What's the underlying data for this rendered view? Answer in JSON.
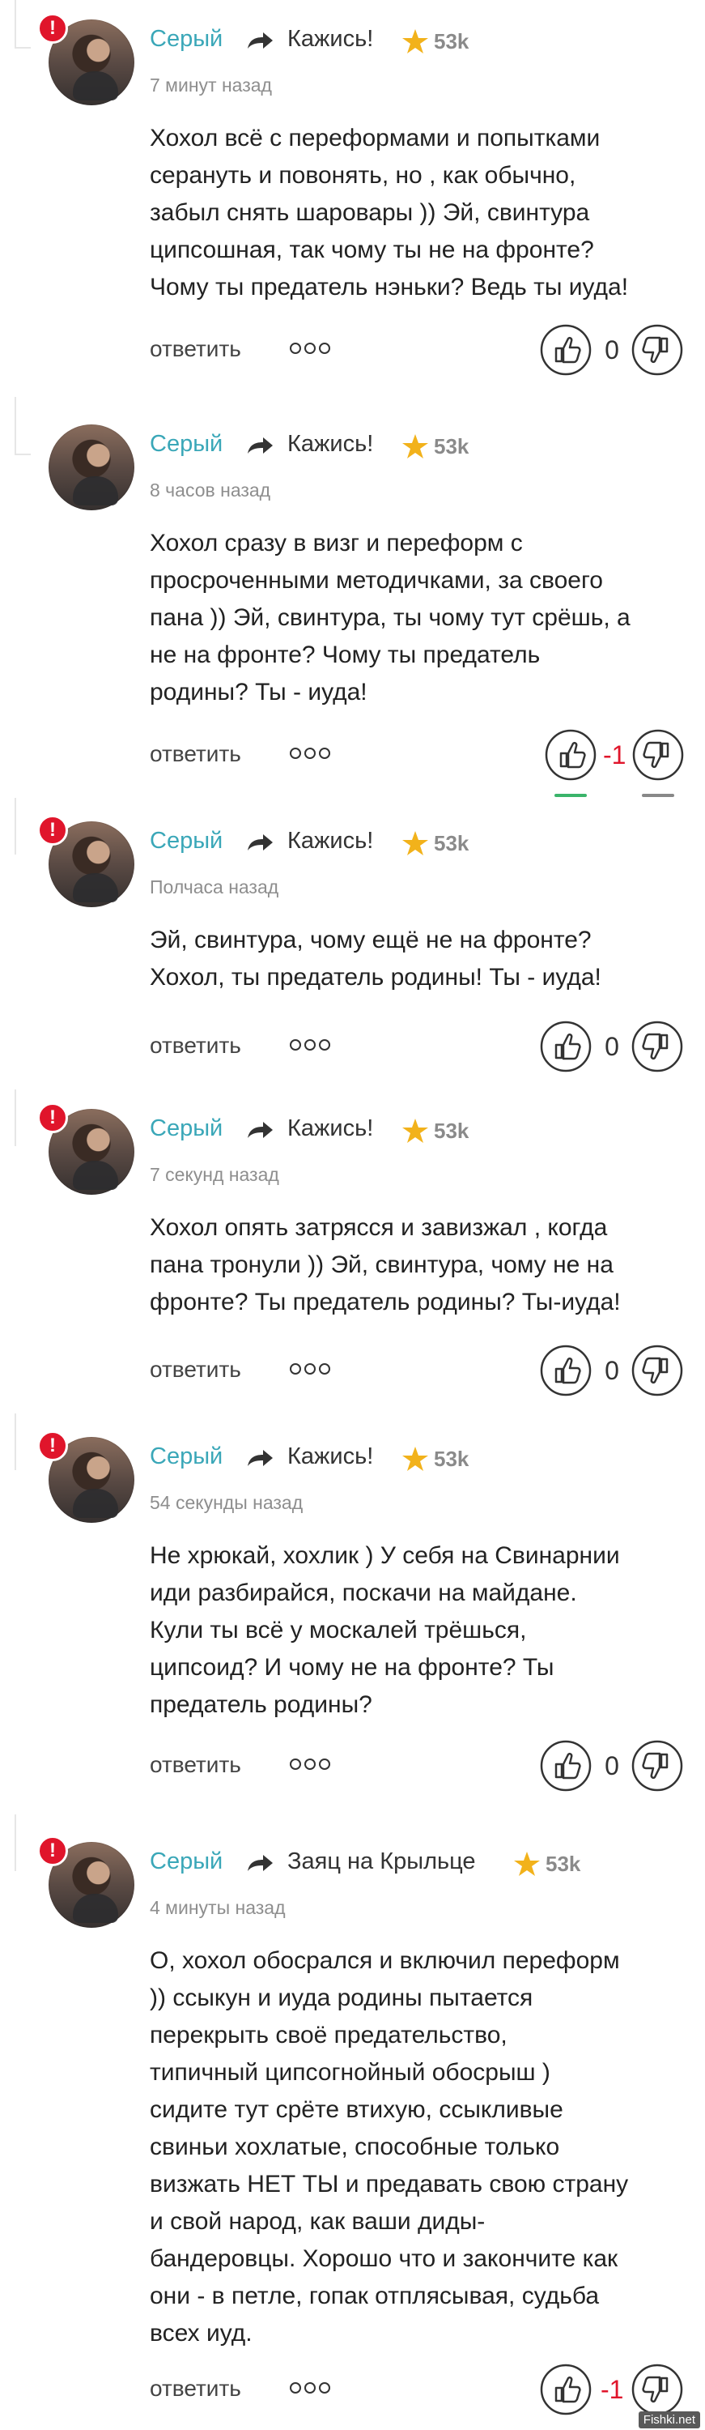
{
  "comments": [
    {
      "author": "Серый",
      "reply_to": "Кажись!",
      "rating": "53k",
      "time": "7 минут назад",
      "text": "Хохол всё с переформами и попытками\nсерануть и повонять, но , как обычно,\nзабыл снять шаровары )) Эй, свинтура\nципсошная, так чому ты не на фронте?\nЧому ты предатель нэньки? Ведь ты иуда!",
      "reply_label": "ответить",
      "score": "0",
      "score_negative": false,
      "flagged": true
    },
    {
      "author": "Серый",
      "reply_to": "Кажись!",
      "rating": "53k",
      "time": "8 часов назад",
      "text": "Хохол сразу в визг и переформ с\nпросроченными методичками, за своего\nпана )) Эй, свинтура, ты чому тут срёшь, а\nне на фронте? Чому ты предатель\nродины? Ты - иуда!",
      "reply_label": "ответить",
      "score": "-1",
      "score_negative": true,
      "flagged": false
    },
    {
      "author": "Серый",
      "reply_to": "Кажись!",
      "rating": "53k",
      "time": "Полчаса назад",
      "text": "Эй, свинтура, чому ещё не на фронте?\nХохол, ты предатель родины! Ты - иуда!",
      "reply_label": "ответить",
      "score": "0",
      "score_negative": false,
      "flagged": true
    },
    {
      "author": "Серый",
      "reply_to": "Кажись!",
      "rating": "53k",
      "time": "7 секунд назад",
      "text": "Хохол опять затрясся и завизжал , когда\nпана тронули )) Эй, свинтура, чому не на\nфронте? Ты предатель родины? Ты-иуда!",
      "reply_label": "ответить",
      "score": "0",
      "score_negative": false,
      "flagged": true
    },
    {
      "author": "Серый",
      "reply_to": "Кажись!",
      "rating": "53k",
      "time": "54 секунды назад",
      "text": "Не хрюкай, хохлик ) У себя на Свинарнии\nиди разбирайся, поскачи на майдане.\nКули ты всё у москалей трёшься,\nципсоид? И чому не на фронте? Ты\nпредатель родины?",
      "reply_label": "ответить",
      "score": "0",
      "score_negative": false,
      "flagged": true
    },
    {
      "author": "Серый",
      "reply_to": "Заяц на Крыльце",
      "rating": "53k",
      "time": "4 минуты назад",
      "text": "О, хохол обосрался и включил переформ\n)) ссыкун и иуда родины пытается\nперекрыть своё предательство,\nтипичный ципсогнойный обосрыш )\nсидите тут срёте втихую, ссыкливые\nсвиньи хохлатые, способные только\nвизжать НЕТ ТЫ и предавать свою страну\nи свой народ, как ваши диды-\nбандеровцы. Хорошо что и закончите как\nони - в петле, гопак отплясывая, судьба\nвсех иуд.",
      "reply_label": "ответить",
      "score": "-1",
      "score_negative": true,
      "flagged": true
    }
  ],
  "icons": {
    "badge": "!",
    "reply_arrow": "reply-arrow-icon",
    "star": "star-icon",
    "more": "more-dots-icon",
    "upvote": "thumb-up-icon",
    "downvote": "thumb-down-icon"
  },
  "colors": {
    "author": "#3aa7b8",
    "badge": "#e0152b",
    "star": "#f2b21b",
    "negative": "#e0152b"
  },
  "watermark": "Fishki.net"
}
